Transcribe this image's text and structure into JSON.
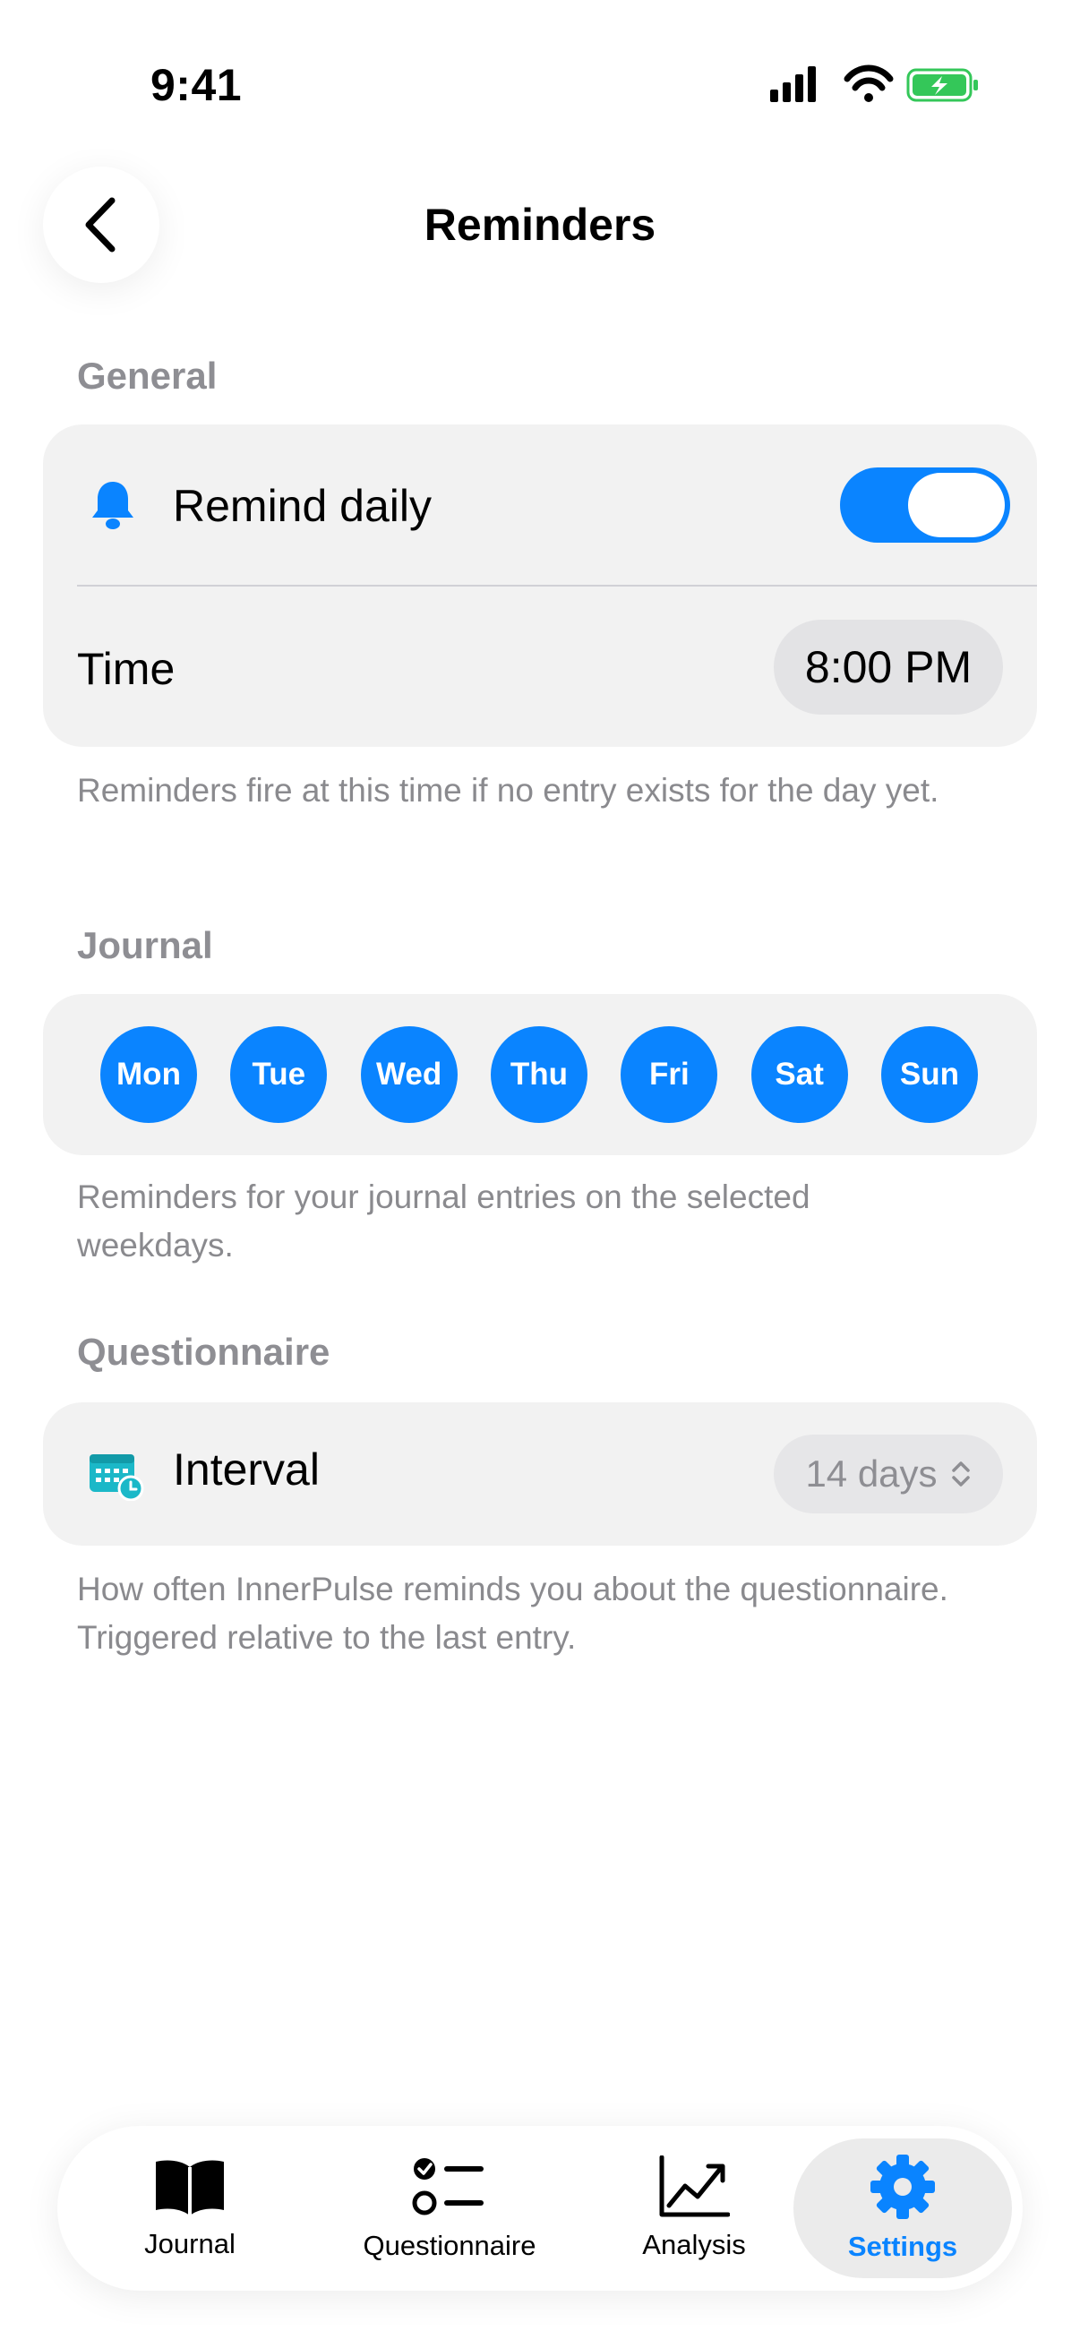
{
  "status_bar": {
    "time": "9:41"
  },
  "header": {
    "title": "Reminders"
  },
  "general": {
    "section_label": "General",
    "remind_daily_label": "Remind daily",
    "remind_daily_enabled": true,
    "time_label": "Time",
    "time_value": "8:00 PM",
    "footnote": "Reminders fire at this time if no entry exists for the day yet."
  },
  "journal": {
    "section_label": "Journal",
    "days": [
      "Mon",
      "Tue",
      "Wed",
      "Thu",
      "Fri",
      "Sat",
      "Sun"
    ],
    "footnote": "Reminders for your journal entries on the selected weekdays."
  },
  "questionnaire": {
    "section_label": "Questionnaire",
    "interval_label": "Interval",
    "interval_value": "14 days",
    "footnote": "How often InnerPulse reminds you about the questionnaire. Triggered relative to the last entry."
  },
  "tabbar": {
    "tabs": [
      {
        "label": "Journal",
        "icon": "book-icon"
      },
      {
        "label": "Questionnaire",
        "icon": "checklist-icon"
      },
      {
        "label": "Analysis",
        "icon": "chart-line-icon"
      },
      {
        "label": "Settings",
        "icon": "gear-icon"
      }
    ],
    "active": "Settings"
  },
  "colors": {
    "accent": "#0a84ff",
    "battery": "#34c759",
    "calendar_icon": "#1bb8c8"
  }
}
